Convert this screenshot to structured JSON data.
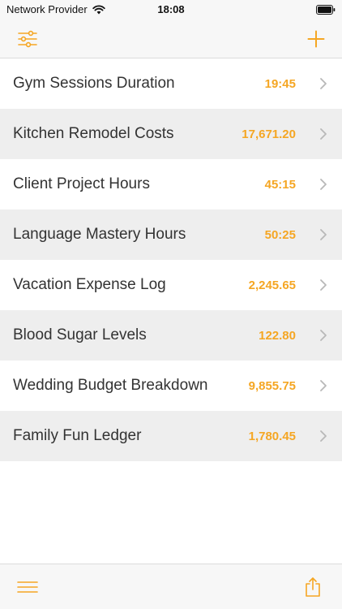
{
  "status_bar": {
    "carrier": "Network Provider",
    "time": "18:08"
  },
  "colors": {
    "accent": "#f5a623",
    "row_alt_background": "#eeeeee",
    "bar_background": "#f7f7f7"
  },
  "header": {
    "left_icon": "sliders-filter-icon",
    "right_icon": "plus-icon"
  },
  "list": {
    "items": [
      {
        "title": "Gym Sessions Duration",
        "value": "19:45"
      },
      {
        "title": "Kitchen Remodel Costs",
        "value": "17,671.20"
      },
      {
        "title": "Client Project Hours",
        "value": "45:15"
      },
      {
        "title": "Language Mastery Hours",
        "value": "50:25"
      },
      {
        "title": "Vacation Expense Log",
        "value": "2,245.65"
      },
      {
        "title": "Blood Sugar Levels",
        "value": "122.80"
      },
      {
        "title": "Wedding Budget Breakdown",
        "value": "9,855.75"
      },
      {
        "title": "Family Fun Ledger",
        "value": "1,780.45"
      }
    ]
  },
  "toolbar": {
    "left_icon": "menu-icon",
    "right_icon": "share-icon"
  }
}
